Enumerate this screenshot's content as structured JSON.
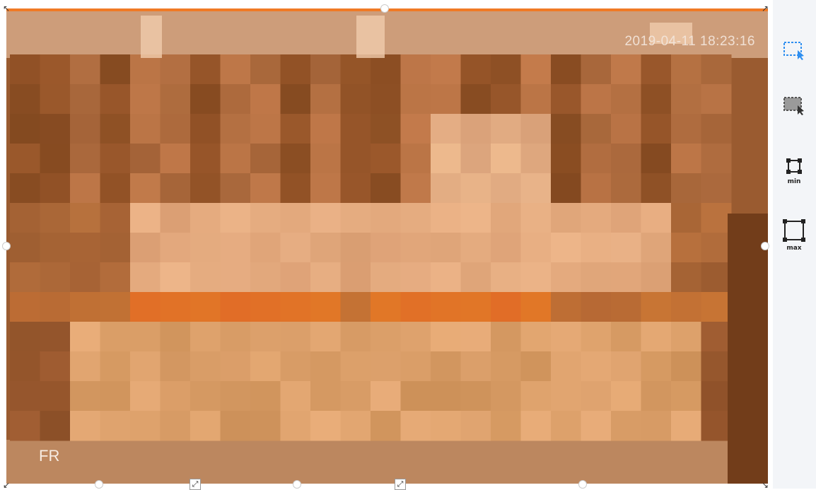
{
  "video": {
    "timestamp": "2019-04-11 18:23:16",
    "channel_label": "FR"
  },
  "toolbar": {
    "tools": [
      {
        "id": "draw-region",
        "icon": "select-area-cursor-icon",
        "label": ""
      },
      {
        "id": "clear-region",
        "icon": "clear-area-cursor-icon",
        "label": ""
      },
      {
        "id": "min-size",
        "icon": "min-box-icon",
        "label": "min"
      },
      {
        "id": "max-size",
        "icon": "max-box-icon",
        "label": "max"
      }
    ]
  },
  "colors": {
    "accent": "#f07a25",
    "tool_blue": "#2f8ff0",
    "toolbar_bg": "#f3f5f8"
  }
}
